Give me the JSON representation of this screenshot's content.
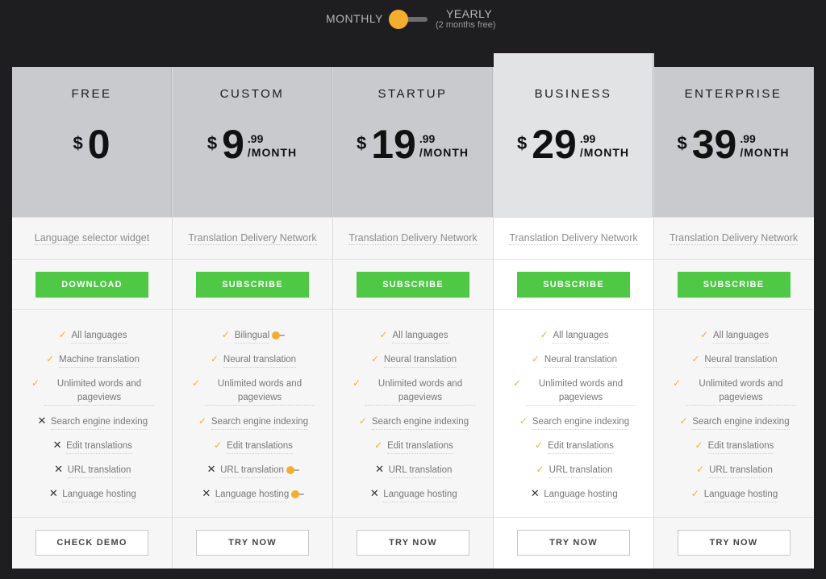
{
  "billing": {
    "monthly_label": "MONTHLY",
    "yearly_label": "YEARLY",
    "yearly_note": "(2 months free)",
    "selected": "monthly",
    "accent_color": "#f5ad30"
  },
  "colors": {
    "background": "#1e1e21",
    "header_gray": "#c8cacd",
    "featured_header": "#e2e3e5",
    "green": "#4ec845",
    "check": "#f5ad30"
  },
  "plans": [
    {
      "name": "FREE",
      "currency": "$",
      "amount": "0",
      "cents": "",
      "period": "",
      "tagline": "Language selector widget",
      "cta": "DOWNLOAD",
      "features": [
        {
          "text": "All languages",
          "included": true
        },
        {
          "text": "Machine translation",
          "included": true
        },
        {
          "text": "Unlimited words and pageviews",
          "included": true
        },
        {
          "text": "Search engine indexing",
          "included": false
        },
        {
          "text": "Edit translations",
          "included": false
        },
        {
          "text": "URL translation",
          "included": false
        },
        {
          "text": "Language hosting",
          "included": false
        }
      ],
      "bottom_button": "CHECK DEMO"
    },
    {
      "name": "CUSTOM",
      "currency": "$",
      "amount": "9",
      "cents": ".99",
      "period": "/MONTH",
      "tagline": "Translation Delivery Network",
      "cta": "SUBSCRIBE",
      "features": [
        {
          "text": "Bilingual",
          "included": true,
          "toggle": true
        },
        {
          "text": "Neural translation",
          "included": true
        },
        {
          "text": "Unlimited words and pageviews",
          "included": true
        },
        {
          "text": "Search engine indexing",
          "included": true
        },
        {
          "text": "Edit translations",
          "included": true
        },
        {
          "text": "URL translation",
          "included": false,
          "toggle": true
        },
        {
          "text": "Language hosting",
          "included": false,
          "toggle": true
        }
      ],
      "bottom_button": "TRY NOW"
    },
    {
      "name": "STARTUP",
      "currency": "$",
      "amount": "19",
      "cents": ".99",
      "period": "/MONTH",
      "tagline": "Translation Delivery Network",
      "cta": "SUBSCRIBE",
      "features": [
        {
          "text": "All languages",
          "included": true
        },
        {
          "text": "Neural translation",
          "included": true
        },
        {
          "text": "Unlimited words and pageviews",
          "included": true
        },
        {
          "text": "Search engine indexing",
          "included": true
        },
        {
          "text": "Edit translations",
          "included": true
        },
        {
          "text": "URL translation",
          "included": false
        },
        {
          "text": "Language hosting",
          "included": false
        }
      ],
      "bottom_button": "TRY NOW"
    },
    {
      "name": "BUSINESS",
      "currency": "$",
      "amount": "29",
      "cents": ".99",
      "period": "/MONTH",
      "tagline": "Translation Delivery Network",
      "cta": "SUBSCRIBE",
      "featured": true,
      "features": [
        {
          "text": "All languages",
          "included": true
        },
        {
          "text": "Neural translation",
          "included": true
        },
        {
          "text": "Unlimited words and pageviews",
          "included": true
        },
        {
          "text": "Search engine indexing",
          "included": true
        },
        {
          "text": "Edit translations",
          "included": true
        },
        {
          "text": "URL translation",
          "included": true
        },
        {
          "text": "Language hosting",
          "included": false
        }
      ],
      "bottom_button": "TRY NOW"
    },
    {
      "name": "ENTERPRISE",
      "currency": "$",
      "amount": "39",
      "cents": ".99",
      "period": "/MONTH",
      "tagline": "Translation Delivery Network",
      "cta": "SUBSCRIBE",
      "features": [
        {
          "text": "All languages",
          "included": true
        },
        {
          "text": "Neural translation",
          "included": true
        },
        {
          "text": "Unlimited words and pageviews",
          "included": true
        },
        {
          "text": "Search engine indexing",
          "included": true
        },
        {
          "text": "Edit translations",
          "included": true
        },
        {
          "text": "URL translation",
          "included": true
        },
        {
          "text": "Language hosting",
          "included": true
        }
      ],
      "bottom_button": "TRY NOW"
    }
  ]
}
